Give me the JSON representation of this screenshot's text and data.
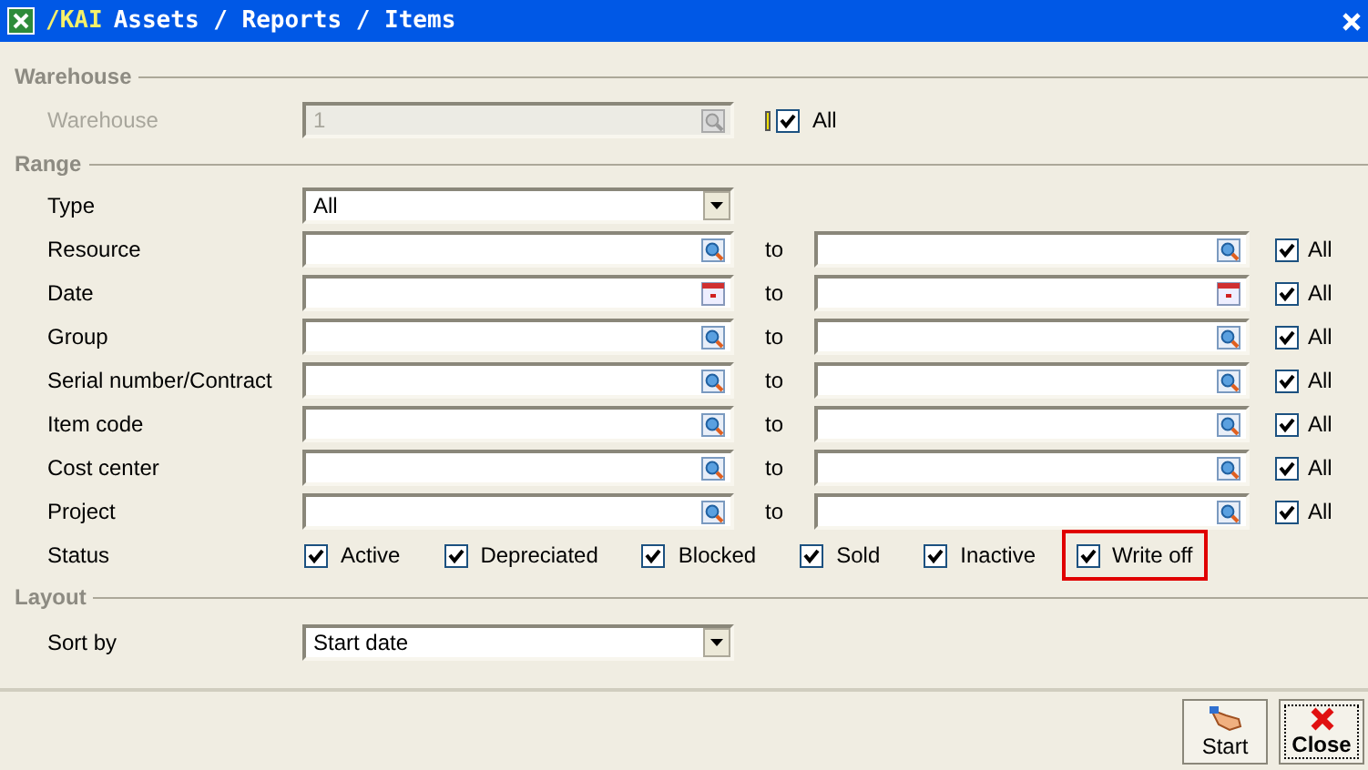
{
  "window": {
    "prefix": "/KAI",
    "title": "Assets / Reports / Items"
  },
  "warehouse": {
    "heading": "Warehouse",
    "label": "Warehouse",
    "value": "1",
    "disabled": true,
    "all_label": "All",
    "all_checked": true
  },
  "range": {
    "heading": "Range",
    "type": {
      "label": "Type",
      "value": "All"
    },
    "rows": [
      {
        "label": "Resource",
        "kind": "lookup",
        "to_label": "to",
        "all_label": "All",
        "all_checked": true
      },
      {
        "label": "Date",
        "kind": "calendar",
        "to_label": "to",
        "all_label": "All",
        "all_checked": true
      },
      {
        "label": "Group",
        "kind": "lookup",
        "to_label": "to",
        "all_label": "All",
        "all_checked": true
      },
      {
        "label": "Serial number/Contract",
        "kind": "lookup",
        "to_label": "to",
        "all_label": "All",
        "all_checked": true
      },
      {
        "label": "Item code",
        "kind": "lookup",
        "to_label": "to",
        "all_label": "All",
        "all_checked": true
      },
      {
        "label": "Cost center",
        "kind": "lookup",
        "to_label": "to",
        "all_label": "All",
        "all_checked": true
      },
      {
        "label": "Project",
        "kind": "lookup",
        "to_label": "to",
        "all_label": "All",
        "all_checked": true
      }
    ],
    "status": {
      "label": "Status",
      "options": [
        {
          "label": "Active",
          "checked": true,
          "highlighted": false
        },
        {
          "label": "Depreciated",
          "checked": true,
          "highlighted": false
        },
        {
          "label": "Blocked",
          "checked": true,
          "highlighted": false
        },
        {
          "label": "Sold",
          "checked": true,
          "highlighted": false
        },
        {
          "label": "Inactive",
          "checked": true,
          "highlighted": false
        },
        {
          "label": "Write off",
          "checked": true,
          "highlighted": true
        }
      ]
    }
  },
  "layout": {
    "heading": "Layout",
    "sort_label": "Sort by",
    "sort_value": "Start date"
  },
  "buttons": [
    {
      "label": "Start",
      "kind": "start"
    },
    {
      "label": "Close",
      "kind": "close"
    }
  ]
}
